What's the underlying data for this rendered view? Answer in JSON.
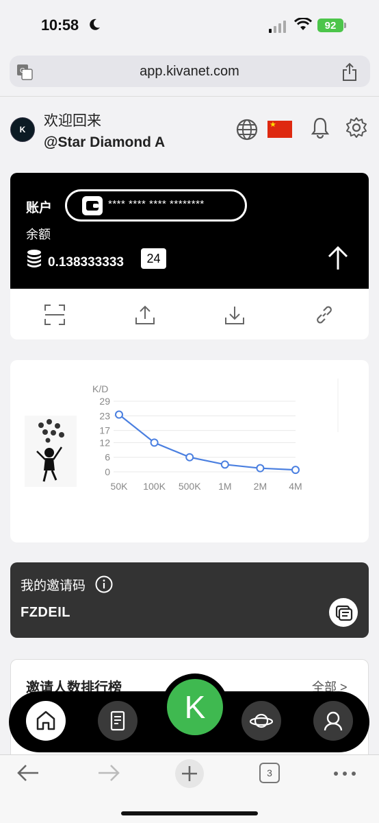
{
  "status_bar": {
    "time": "10:58",
    "battery": "92"
  },
  "browser": {
    "url": "app.kivanet.com",
    "tabs_count": "3"
  },
  "header": {
    "welcome": "欢迎回来",
    "username": "@Star Diamond A"
  },
  "account": {
    "label": "账户",
    "number_masked": "**** **** **** ********",
    "balance_label": "余额",
    "balance_value": "0.138333333",
    "balance_badge": "24"
  },
  "chart_data": {
    "type": "line",
    "ylabel": "K/D",
    "categories": [
      "50K",
      "100K",
      "500K",
      "1M",
      "2M",
      "4M"
    ],
    "y_ticks": [
      "0",
      "6",
      "12",
      "17",
      "23",
      "29"
    ],
    "ylim": [
      0,
      29
    ],
    "series": [
      {
        "values": [
          23.5,
          12,
          6,
          3,
          1.5,
          0.8
        ]
      }
    ],
    "grid": true,
    "color": "#4a7fe0"
  },
  "invite": {
    "label": "我的邀请码",
    "code": "FZDEIL"
  },
  "ranking": {
    "title": "邀请人数排行榜",
    "all_link": "全部 >"
  },
  "bottom_nav": {
    "center_label": "K"
  },
  "icons": [
    "translate-icon",
    "share-icon",
    "globe-icon",
    "bell-icon",
    "gear-icon",
    "scan-icon",
    "upload-icon",
    "download-icon",
    "link-icon",
    "info-icon",
    "copy-icon",
    "home-icon",
    "docs-icon",
    "planet-icon",
    "profile-icon"
  ]
}
